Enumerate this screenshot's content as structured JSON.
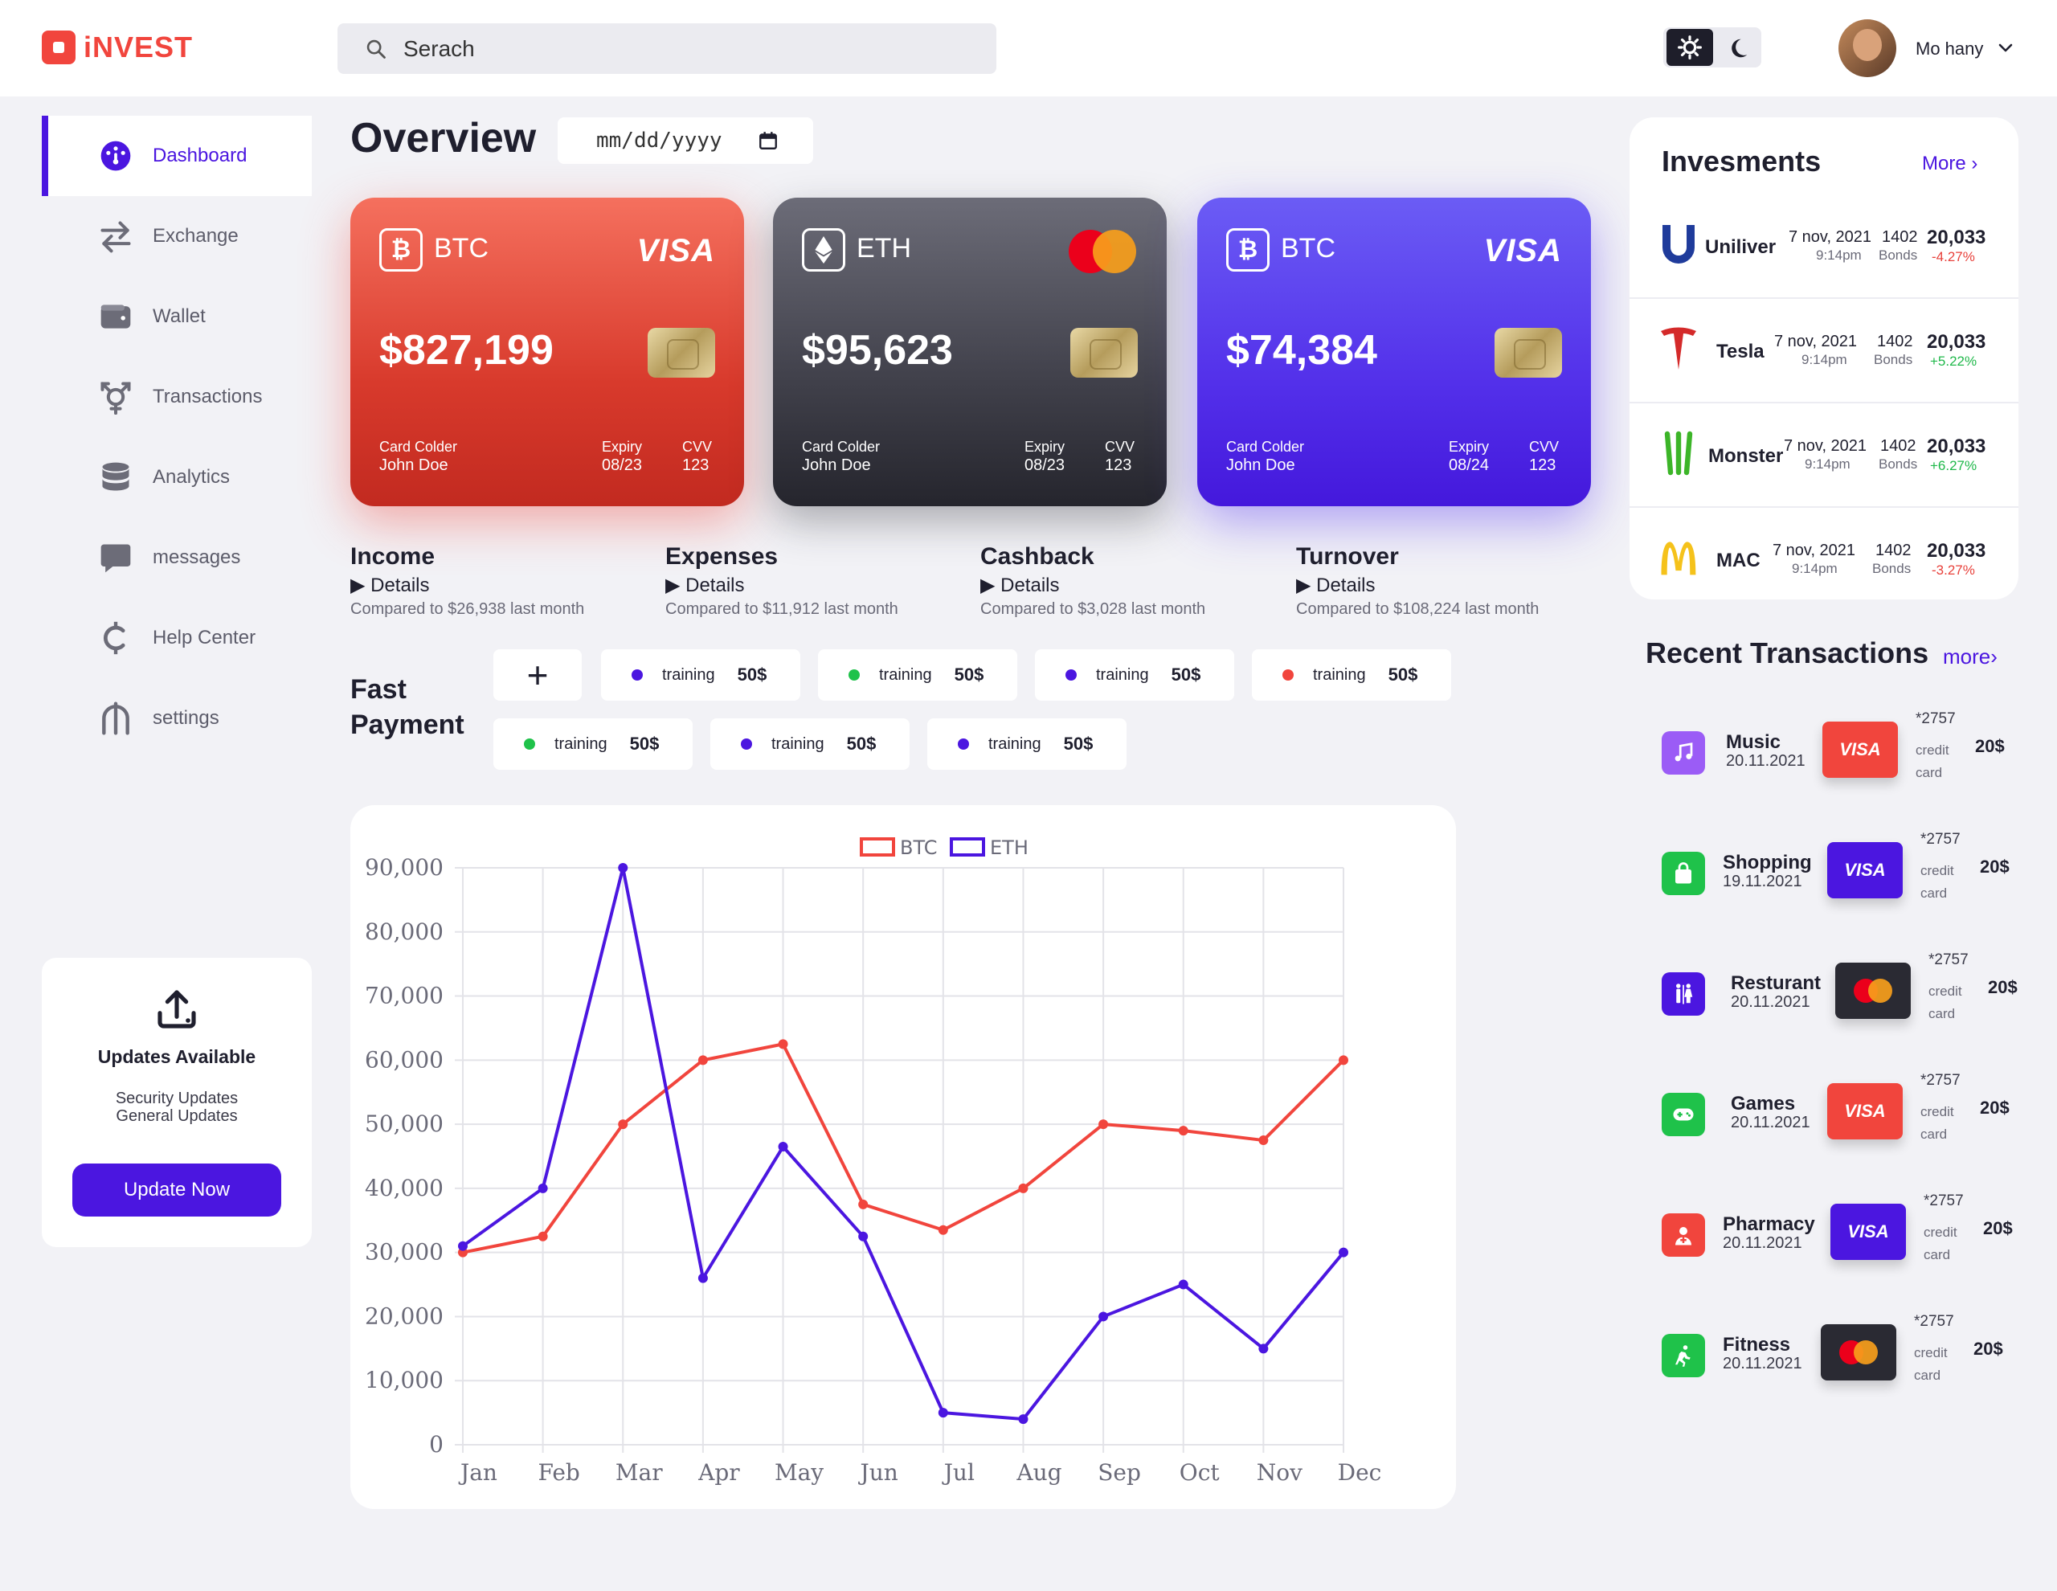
{
  "app": {
    "brand": "iNVEST",
    "search_placeholder": "Serach",
    "user_name": "Mo hany"
  },
  "colors": {
    "accent": "#4b16e0",
    "brand_red": "#f1453d",
    "positive": "#1fb84a",
    "negative": "#e8413b"
  },
  "sidebar": {
    "items": [
      {
        "label": "Dashboard",
        "icon": "dashboard-icon",
        "active": true
      },
      {
        "label": "Exchange",
        "icon": "exchange-arrows-icon"
      },
      {
        "label": "Wallet",
        "icon": "wallet-icon"
      },
      {
        "label": "Transactions",
        "icon": "transactions-icon"
      },
      {
        "label": "Analytics",
        "icon": "database-icon"
      },
      {
        "label": "messages",
        "icon": "message-icon"
      },
      {
        "label": "Help Center",
        "icon": "help-icon"
      },
      {
        "label": "settings",
        "icon": "settings-icon"
      }
    ],
    "update_card": {
      "icon": "upload-icon",
      "title": "Updates Available",
      "line1": "Security Updates",
      "line2": "General Updates",
      "button": "Update Now"
    }
  },
  "overview": {
    "title": "Overview",
    "date_placeholder": "mm/dd/yyyy"
  },
  "cards": [
    {
      "coin": "BTC",
      "coin_icon": "bitcoin-icon",
      "network": "VISA",
      "amount": "$827,199",
      "holder_label": "Card Colder",
      "holder": "John Doe",
      "expiry_label": "Expiry",
      "expiry": "08/23",
      "cvv_label": "CVV",
      "cvv": "123"
    },
    {
      "coin": "ETH",
      "coin_icon": "ethereum-icon",
      "network": "mastercard",
      "amount": "$95,623",
      "holder_label": "Card Colder",
      "holder": "John Doe",
      "expiry_label": "Expiry",
      "expiry": "08/23",
      "cvv_label": "CVV",
      "cvv": "123"
    },
    {
      "coin": "BTC",
      "coin_icon": "bitcoin-icon",
      "network": "VISA",
      "amount": "$74,384",
      "holder_label": "Card Colder",
      "holder": "John Doe",
      "expiry_label": "Expiry",
      "expiry": "08/24",
      "cvv_label": "CVV",
      "cvv": "123"
    }
  ],
  "stats": [
    {
      "title": "Income",
      "details": "Details",
      "compare": "Compared to $26,938 last month"
    },
    {
      "title": "Expenses",
      "details": "Details",
      "compare": "Compared to $11,912 last month"
    },
    {
      "title": "Cashback",
      "details": "Details",
      "compare": "Compared to $3,028 last month"
    },
    {
      "title": "Turnover",
      "details": "Details",
      "compare": "Compared to $108,224 last month"
    }
  ],
  "fast_payment": {
    "title": "Fast Payment",
    "add_label": "+",
    "items": [
      {
        "label": "training",
        "amount": "50$",
        "color": "#4b16e0"
      },
      {
        "label": "training",
        "amount": "50$",
        "color": "#1fc24a"
      },
      {
        "label": "training",
        "amount": "50$",
        "color": "#4b16e0"
      },
      {
        "label": "training",
        "amount": "50$",
        "color": "#f1453d"
      },
      {
        "label": "training",
        "amount": "50$",
        "color": "#1fc24a"
      },
      {
        "label": "training",
        "amount": "50$",
        "color": "#4b16e0"
      },
      {
        "label": "training",
        "amount": "50$",
        "color": "#4b16e0"
      }
    ]
  },
  "chart_data": {
    "type": "line",
    "categories": [
      "Jan",
      "Feb",
      "Mar",
      "Apr",
      "May",
      "Jun",
      "Jul",
      "Aug",
      "Sep",
      "Oct",
      "Nov",
      "Dec"
    ],
    "series": [
      {
        "name": "BTC",
        "color": "#f1453d",
        "values": [
          30000,
          32500,
          50000,
          60000,
          62500,
          37500,
          33500,
          40000,
          50000,
          49000,
          47500,
          60000
        ]
      },
      {
        "name": "ETH",
        "color": "#4b16e0",
        "values": [
          31000,
          40000,
          90000,
          26000,
          46500,
          32500,
          5000,
          4000,
          20000,
          25000,
          15000,
          30000
        ]
      }
    ],
    "yticks": [
      "0",
      "10,000",
      "20,000",
      "30,000",
      "40,000",
      "50,000",
      "60,000",
      "70,000",
      "80,000",
      "90,000"
    ],
    "ylim": [
      0,
      90000
    ],
    "grid": true,
    "legend": "top-center"
  },
  "investments": {
    "title": "Invesments",
    "more": "More",
    "items": [
      {
        "name": "Uniliver",
        "logo": "unilever-logo-icon",
        "date": "7 nov, 2021",
        "time": "9:14pm",
        "count": "1402",
        "unit": "Bonds",
        "value": "20,033",
        "change": "-4.27%",
        "positive": false
      },
      {
        "name": "Tesla",
        "logo": "tesla-logo-icon",
        "date": "7 nov, 2021",
        "time": "9:14pm",
        "count": "1402",
        "unit": "Bonds",
        "value": "20,033",
        "change": "+5.22%",
        "positive": true
      },
      {
        "name": "Monster",
        "logo": "monster-logo-icon",
        "date": "7 nov, 2021",
        "time": "9:14pm",
        "count": "1402",
        "unit": "Bonds",
        "value": "20,033",
        "change": "+6.27%",
        "positive": true
      },
      {
        "name": "MAC",
        "logo": "mcdonalds-logo-icon",
        "date": "7 nov, 2021",
        "time": "9:14pm",
        "count": "1402",
        "unit": "Bonds",
        "value": "20,033",
        "change": "-3.27%",
        "positive": false
      }
    ]
  },
  "transactions": {
    "title": "Recent Transactions",
    "more": "more",
    "items": [
      {
        "name": "Music",
        "date": "20.11.2021",
        "icon": "music-note-icon",
        "icon_bg": "#9b5cf6",
        "card": "VISA",
        "card_bg": "#f1453d",
        "card_num": "*2757",
        "type1": "credit",
        "type2": "card",
        "amount": "20$"
      },
      {
        "name": "Shopping",
        "date": "19.11.2021",
        "icon": "shopping-bag-icon",
        "icon_bg": "#1fc24a",
        "card": "VISA",
        "card_bg": "#4b16e0",
        "card_num": "*2757",
        "type1": "credit",
        "type2": "card",
        "amount": "20$"
      },
      {
        "name": "Resturant",
        "date": "20.11.2021",
        "icon": "restroom-icon",
        "icon_bg": "#4b16e0",
        "card": "mastercard",
        "card_bg": "#2a2a33",
        "card_num": "*2757",
        "type1": "credit",
        "type2": "card",
        "amount": "20$"
      },
      {
        "name": "Games",
        "date": "20.11.2021",
        "icon": "gamepad-icon",
        "icon_bg": "#1fc24a",
        "card": "VISA",
        "card_bg": "#f1453d",
        "card_num": "*2757",
        "type1": "credit",
        "type2": "card",
        "amount": "20$"
      },
      {
        "name": "Pharmacy",
        "date": "20.11.2021",
        "icon": "pharmacy-icon",
        "icon_bg": "#f1453d",
        "card": "VISA",
        "card_bg": "#4b16e0",
        "card_num": "*2757",
        "type1": "credit",
        "type2": "card",
        "amount": "20$"
      },
      {
        "name": "Fitness",
        "date": "20.11.2021",
        "icon": "running-icon",
        "icon_bg": "#1fc24a",
        "card": "mastercard",
        "card_bg": "#2a2a33",
        "card_num": "*2757",
        "type1": "credit",
        "type2": "card",
        "amount": "20$"
      }
    ]
  }
}
